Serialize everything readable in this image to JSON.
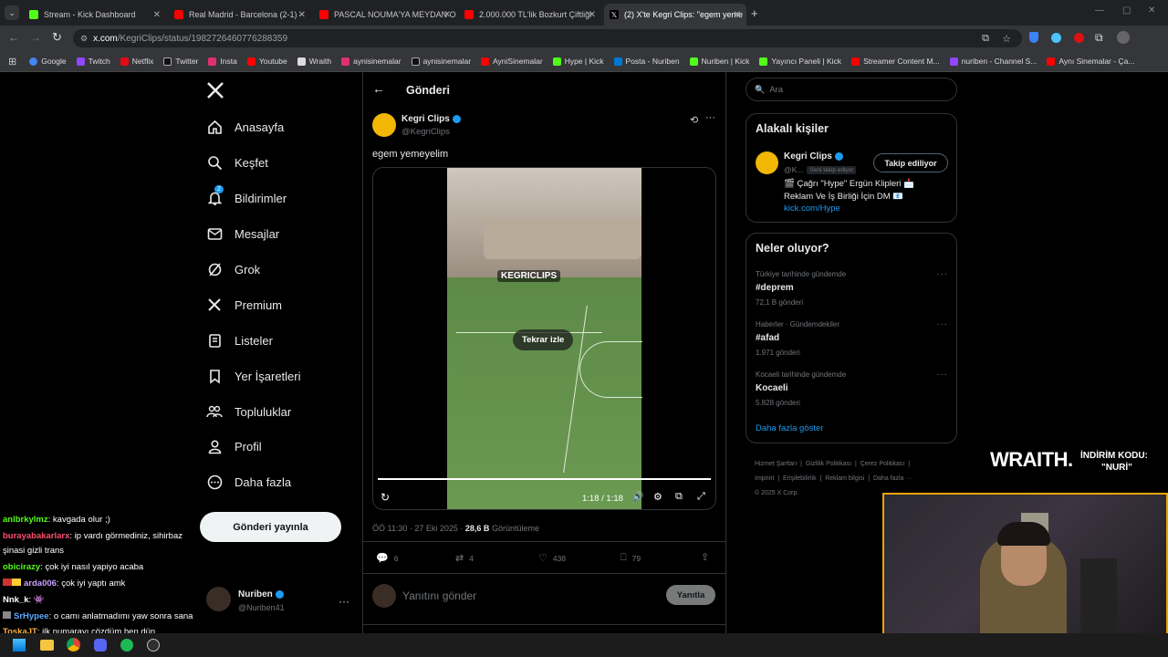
{
  "browser": {
    "tabs": [
      {
        "label": "Stream - Kick Dashboard",
        "color": "#53fc18"
      },
      {
        "label": "Real Madrid - Barcelona (2-1) -",
        "color": "#ff0000"
      },
      {
        "label": "PASCAL NOUMA'YA MEYDAN O",
        "color": "#ff0000"
      },
      {
        "label": "2.000.000 TL'lik Bozkurt Çiftliği",
        "color": "#ff0000"
      },
      {
        "label": "(2) X'te Kegri Clips: \"egem yeme",
        "color": "#ffffff"
      }
    ],
    "url_domain": "x.com",
    "url_path": "/KegriClips/status/1982726460776288359",
    "bookmarks": [
      {
        "label": "Google",
        "color": "#4285f4"
      },
      {
        "label": "Twitch",
        "color": "#9146ff"
      },
      {
        "label": "Netflix",
        "color": "#e50914"
      },
      {
        "label": "Twitter",
        "color": "#ffffff"
      },
      {
        "label": "Insta",
        "color": "#e1306c"
      },
      {
        "label": "Youtube",
        "color": "#ff0000"
      },
      {
        "label": "Wraith",
        "color": "#ffffff"
      },
      {
        "label": "aynisinemalar",
        "color": "#e1306c"
      },
      {
        "label": "aynisinemalar",
        "color": "#ffffff"
      },
      {
        "label": "AyniSinemalar",
        "color": "#ff0000"
      },
      {
        "label": "Hype | Kick",
        "color": "#53fc18"
      },
      {
        "label": "Posta - Nuriben",
        "color": "#0078d4"
      },
      {
        "label": "Nuriben | Kick",
        "color": "#53fc18"
      },
      {
        "label": "Yayıncı Paneli | Kick",
        "color": "#53fc18"
      },
      {
        "label": "Streamer Content M...",
        "color": "#ff0000"
      },
      {
        "label": "nuriben - Channel S...",
        "color": "#9146ff"
      },
      {
        "label": "Aynı Sinemalar - Ça...",
        "color": "#ff0000"
      }
    ]
  },
  "nav": {
    "items": [
      "Anasayfa",
      "Keşfet",
      "Bildirimler",
      "Mesajlar",
      "Grok",
      "Premium",
      "Listeler",
      "Yer İşaretleri",
      "Topluluklar",
      "Profil",
      "Daha fazla"
    ],
    "notif_badge": "2",
    "post_button": "Gönderi yayınla",
    "account_name": "Nuriben",
    "account_handle": "@Nuriben41"
  },
  "post": {
    "header_title": "Gönderi",
    "author_name": "Kegri Clips",
    "author_handle": "@KegriClips",
    "text": "egem yemeyelim",
    "replay_label": "Tekrar izle",
    "video_watermark": "KEGRICLIPS",
    "video_time": "1:18 / 1:18",
    "timestamp": "ÖÖ 11:30 · 27 Eki 2025 · ",
    "views": "28,6 B",
    "views_label": "Görüntüleme",
    "replies": "6",
    "reposts": "4",
    "likes": "438",
    "bookmarks": "79",
    "reply_placeholder": "Yanıtını gönder",
    "reply_button": "Yanıtla"
  },
  "sidebar": {
    "search_placeholder": "Ara",
    "related_title": "Alakalı kişiler",
    "related_name": "Kegri Clips",
    "related_handle": "@K...",
    "follows_you": "Seni takip ediyor",
    "following_button": "Takip ediliyor",
    "bio_line1": "🎬 Çağrı \"Hype\" Ergün Klipleri 📩",
    "bio_line2": "Reklam Ve İş Birliği İçin DM 📧",
    "bio_link": "kick.com/Hype",
    "trends_title": "Neler oluyor?",
    "trends": [
      {
        "category": "Türkiye tarihinde gündemde",
        "title": "#deprem",
        "count": "72,1 B gönderi"
      },
      {
        "category": "Haberler · Gündemdekiler",
        "title": "#afad",
        "count": "1.971 gönderi"
      },
      {
        "category": "Kocaeli tarihinde gündemde",
        "title": "Kocaeli",
        "count": "5.828 gönderi"
      }
    ],
    "show_more": "Daha fazla göster",
    "footer_line1": [
      "Hizmet Şartları",
      "Gizlilik Politikası",
      "Çerez Politikası"
    ],
    "footer_line2": [
      "Imprint",
      "Erişilebilirlik",
      "Reklam bilgisi",
      "Daha fazla ···"
    ],
    "copyright": "© 2025 X Corp."
  },
  "chat": [
    {
      "user": "anlbrkylmz",
      "color": "#53fc18",
      "msg": ": kavgada olur ;)"
    },
    {
      "user": "burayabakarlarx",
      "color": "#ff4d6d",
      "msg": ": ip vardı görmediniz, sihirbaz"
    },
    {
      "user": "",
      "color": "#ffffff",
      "msg": "şinasi gizli trans"
    },
    {
      "user": "obicirazy",
      "color": "#53fc18",
      "msg": ": çok iyi nasıl yapiyo acaba"
    },
    {
      "user": "arda006",
      "color": "#c9a0ff",
      "msg": ": çok iyi yaptı amk"
    },
    {
      "user": "Nnk_k",
      "color": "#ffffff",
      "msg": ": 👾"
    },
    {
      "user": "SrHypee",
      "color": "#5aa9ff",
      "msg": ": o camı anlatmadımı yaw sonra sana"
    },
    {
      "user": "ToskaJT",
      "color": "#ffb347",
      "msg": ": ilk numarayı çözdüm ben dün"
    }
  ],
  "overlay": {
    "brand": "WRAITH.",
    "code_label": "İNDİRİM KODU:",
    "code_value": "\"NURİ\""
  }
}
